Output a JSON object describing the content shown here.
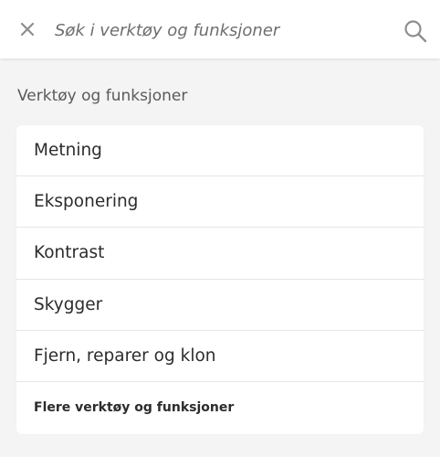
{
  "search": {
    "placeholder": "Søk i verktøy og funksjoner"
  },
  "icons": {
    "close": "close-icon",
    "search": "search-icon"
  },
  "section": {
    "title": "Verktøy og funksjoner"
  },
  "items": [
    {
      "label": "Metning"
    },
    {
      "label": "Eksponering"
    },
    {
      "label": "Kontrast"
    },
    {
      "label": "Skygger"
    },
    {
      "label": "Fjern, reparer og klon"
    }
  ],
  "more": {
    "label": "Flere verktøy og funksjoner"
  },
  "colors": {
    "background": "#f4f4f4",
    "card": "#ffffff",
    "text": "#2c2c2c",
    "muted": "#6e6e6e",
    "icon": "#8e8e8e"
  }
}
